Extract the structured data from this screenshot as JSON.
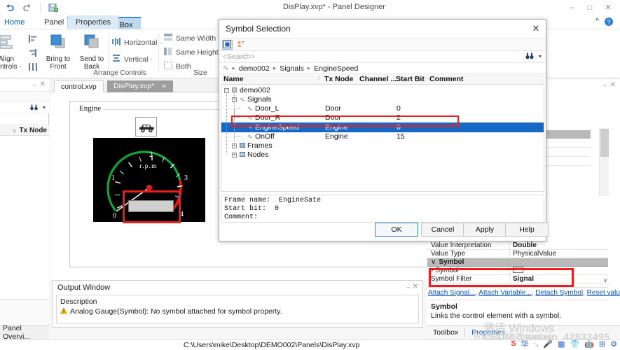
{
  "window": {
    "title": "DisPlay.xvp* - Panel Designer",
    "minimize": "–",
    "maximize": "□",
    "close": "✕"
  },
  "quick_access": {
    "undo": "undo-icon",
    "redo": "redo-icon",
    "save_as": "save-as-icon"
  },
  "ribbon": {
    "contextual_tab": "Input/Output Box",
    "tabs": [
      {
        "label": "Home"
      },
      {
        "label": "Panel"
      },
      {
        "label": "Properties"
      }
    ],
    "collapse": "^",
    "help": "?",
    "groups": [
      {
        "label": "Arrange Controls",
        "buttons": [
          {
            "label1": "Align",
            "label2": "Controls ·"
          },
          {
            "label1": "Bring to",
            "label2": "Front"
          },
          {
            "label1": "Send to",
            "label2": "Back"
          }
        ],
        "small_items": [
          {
            "label": "Horizontal ·"
          },
          {
            "label": "Vertical ·"
          }
        ]
      },
      {
        "label": "Size",
        "small_items": [
          {
            "label": "Same Width"
          },
          {
            "label": "Same Height"
          },
          {
            "label": "Both"
          }
        ]
      }
    ]
  },
  "left_panel": {
    "title_pin": "–",
    "title_close": "✕",
    "search_icon": "binoculars-icon",
    "search_caret": "▾",
    "column_header": "Tx Node",
    "sort_mark": "∨",
    "expand_arrow": "›",
    "bottom_tab": "Panel Overvi..."
  },
  "documents": {
    "tabs": [
      {
        "label": "control.xvp",
        "state": "inactive"
      },
      {
        "label": "DisPlay.xvp*",
        "state": "selected",
        "close": "✕"
      }
    ]
  },
  "canvas": {
    "group_label": "Engine",
    "gauge": {
      "unit_label": "r.p.m",
      "ticks": [
        "0",
        "1",
        "2",
        "3",
        "4"
      ],
      "green_color": "#12a63a",
      "red_color": "#e01b1b",
      "needle_color": "#ffffff",
      "hub_color": "#e01b1b",
      "background": "#000000"
    },
    "selection_box_color": "#ee1c1c"
  },
  "output_window": {
    "title": "Output Window",
    "pin": "–",
    "close": "✕",
    "description_header": "Description",
    "warning_icon": "warning-triangle-icon",
    "message": "Analog Gauge(Symbol): No symbol attached for symbol property."
  },
  "properties_panel": {
    "pin": "–",
    "close": "✕",
    "hidden_row_value": "Box",
    "rows": [
      {
        "key": "Value Interpretation",
        "value": "Double",
        "bold": true
      },
      {
        "key": "Value Type",
        "value": "PhysicalValue",
        "bold": false
      },
      {
        "key": "Symbol",
        "value": "",
        "category": true,
        "expander": "∨"
      },
      {
        "key": "Symbol",
        "value": "",
        "expander": "›",
        "editor": "color-swatch"
      },
      {
        "key": "Symbol Filter",
        "value": "Signal",
        "bold": true
      }
    ],
    "links": [
      "Attach Signal...",
      "Attach Variable...",
      "Detach Symbol",
      "Reset values"
    ],
    "description_title": "Symbol",
    "description_text": "Links the control element with a symbol.",
    "tabs": [
      {
        "label": "Toolbox",
        "active": false
      },
      {
        "label": "Properties",
        "active": true
      }
    ],
    "scroll_down_arrow": "∨",
    "highlight_color": "#ee1c1c"
  },
  "dialog": {
    "title": "Symbol Selection",
    "close": "✕",
    "toolbar": [
      {
        "icon": "flat-view-icon",
        "active": true
      },
      {
        "icon": "tree-view-icon",
        "active": false
      }
    ],
    "search_placeholder": "<Search>",
    "search_icon": "binoculars-icon",
    "search_caret": "▾",
    "breadcrumb": [
      "demo002",
      "Signals",
      "EngineSpeed"
    ],
    "breadcrumb_root_icon": "signal-icon",
    "columns": [
      "Name",
      "Tx Node",
      "Channel ...",
      "Start Bit",
      "Comment"
    ],
    "tree": [
      {
        "level": 0,
        "name": "demo002",
        "tx": "",
        "start_bit": "",
        "type": "db",
        "expander": "-"
      },
      {
        "level": 1,
        "name": "Signals",
        "tx": "",
        "start_bit": "",
        "type": "folder",
        "expander": "-"
      },
      {
        "level": 2,
        "name": "Door_L",
        "tx": "Door",
        "start_bit": "0",
        "type": "signal"
      },
      {
        "level": 2,
        "name": "Door_R",
        "tx": "Door",
        "start_bit": "2",
        "type": "signal"
      },
      {
        "level": 2,
        "name": "EngineSpeed",
        "tx": "Engine",
        "start_bit": "0",
        "type": "signal",
        "selected": true
      },
      {
        "level": 2,
        "name": "OnOff",
        "tx": "Engine",
        "start_bit": "15",
        "type": "signal"
      },
      {
        "level": 1,
        "name": "Frames",
        "tx": "",
        "start_bit": "",
        "type": "folder",
        "expander": "+"
      },
      {
        "level": 1,
        "name": "Nodes",
        "tx": "",
        "start_bit": "",
        "type": "folder",
        "expander": "+"
      }
    ],
    "info": {
      "frame_name_label": "Frame name:",
      "frame_name_value": "EngineSate",
      "start_bit_label": "Start bit:",
      "start_bit_value": "0",
      "comment_label": "Comment:"
    },
    "buttons": [
      {
        "label": "OK",
        "default": true
      },
      {
        "label": "Cancel",
        "default": false
      },
      {
        "label": "Apply",
        "default": false
      },
      {
        "label": "Help",
        "default": false
      }
    ],
    "selection_highlight_color": "#ee1c1c"
  },
  "status_bar": {
    "path": "C:\\Users\\mike\\Desktop\\DEMO002\\Panels\\DisPlay.xvp"
  },
  "watermark": {
    "activate_windows": "激活 Windows",
    "activate_sub": "转到设置以激活 Windows",
    "csdn": "CSDN @weixin_42833495"
  }
}
